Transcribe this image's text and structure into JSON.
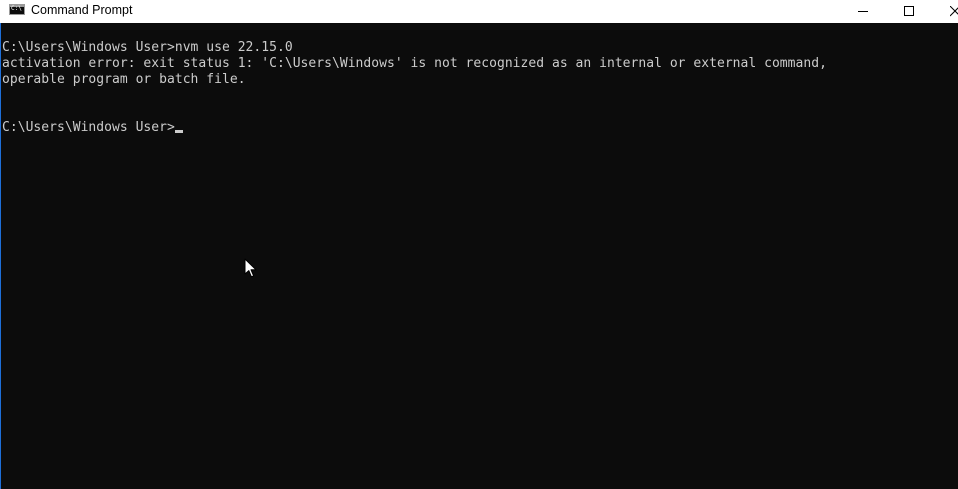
{
  "window": {
    "title": "Command Prompt"
  },
  "console": {
    "lines": [
      "C:\\Users\\Windows User>nvm use 22.15.0",
      "activation error: exit status 1: 'C:\\Users\\Windows' is not recognized as an internal or external command,",
      "operable program or batch file.",
      "",
      "",
      "C:\\Users\\Windows User>"
    ]
  },
  "icons": {
    "app": "command-prompt-icon",
    "minimize": "minimize-icon",
    "maximize": "maximize-icon",
    "close": "close-icon",
    "pointer": "mouse-pointer-icon"
  },
  "colors": {
    "background": "#0c0c0c",
    "text": "#cccccc",
    "titlebar": "#ffffff"
  }
}
